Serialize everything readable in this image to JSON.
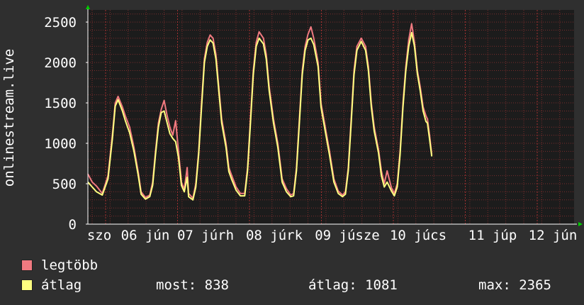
{
  "chart_data": {
    "type": "line",
    "ylabel": "onlinestream.live",
    "yticks": [
      "0",
      "500",
      "1000",
      "1500",
      "2000",
      "2500"
    ],
    "ylim": [
      0,
      2650
    ],
    "day_labels": [
      "szo",
      "06 jún",
      "07 júrh",
      "08 júrk",
      "09 júsze",
      "10 júcs",
      "11 júp",
      "12 jún"
    ],
    "grid": true,
    "colors": {
      "legtobb": "#f07a80",
      "atlag": "#ffff80",
      "background": "#1c1c1c",
      "grid": "#7a2c2c",
      "axis": "#ffffff",
      "arrow": "#00cc00"
    },
    "series": [
      {
        "name": "legtöbb",
        "color": "#f07a80",
        "points": [
          [
            0,
            620
          ],
          [
            0.06,
            520
          ],
          [
            0.12,
            470
          ],
          [
            0.2,
            380
          ],
          [
            0.28,
            600
          ],
          [
            0.34,
            1100
          ],
          [
            0.38,
            1500
          ],
          [
            0.42,
            1580
          ],
          [
            0.48,
            1450
          ],
          [
            0.52,
            1340
          ],
          [
            0.58,
            1200
          ],
          [
            0.64,
            950
          ],
          [
            0.7,
            640
          ],
          [
            0.74,
            400
          ],
          [
            0.8,
            330
          ],
          [
            0.86,
            360
          ],
          [
            0.9,
            520
          ],
          [
            0.94,
            900
          ],
          [
            0.98,
            1250
          ],
          [
            1.02,
            1420
          ],
          [
            1.06,
            1530
          ],
          [
            1.1,
            1350
          ],
          [
            1.14,
            1200
          ],
          [
            1.18,
            1100
          ],
          [
            1.22,
            1280
          ],
          [
            1.26,
            900
          ],
          [
            1.3,
            520
          ],
          [
            1.34,
            430
          ],
          [
            1.38,
            700
          ],
          [
            1.4,
            380
          ],
          [
            1.46,
            320
          ],
          [
            1.5,
            500
          ],
          [
            1.54,
            900
          ],
          [
            1.58,
            1500
          ],
          [
            1.62,
            2050
          ],
          [
            1.66,
            2250
          ],
          [
            1.7,
            2340
          ],
          [
            1.74,
            2300
          ],
          [
            1.78,
            2100
          ],
          [
            1.82,
            1700
          ],
          [
            1.86,
            1300
          ],
          [
            1.92,
            1000
          ],
          [
            1.96,
            700
          ],
          [
            2.0,
            600
          ],
          [
            2.06,
            460
          ],
          [
            2.12,
            380
          ],
          [
            2.18,
            380
          ],
          [
            2.22,
            700
          ],
          [
            2.26,
            1300
          ],
          [
            2.3,
            1900
          ],
          [
            2.34,
            2250
          ],
          [
            2.38,
            2380
          ],
          [
            2.44,
            2300
          ],
          [
            2.48,
            2100
          ],
          [
            2.52,
            1700
          ],
          [
            2.58,
            1300
          ],
          [
            2.64,
            1000
          ],
          [
            2.7,
            560
          ],
          [
            2.76,
            440
          ],
          [
            2.82,
            360
          ],
          [
            2.86,
            380
          ],
          [
            2.9,
            700
          ],
          [
            2.94,
            1300
          ],
          [
            2.98,
            1900
          ],
          [
            3.02,
            2200
          ],
          [
            3.06,
            2350
          ],
          [
            3.1,
            2440
          ],
          [
            3.14,
            2300
          ],
          [
            3.2,
            2000
          ],
          [
            3.24,
            1500
          ],
          [
            3.3,
            1200
          ],
          [
            3.36,
            900
          ],
          [
            3.42,
            560
          ],
          [
            3.48,
            410
          ],
          [
            3.54,
            360
          ],
          [
            3.58,
            400
          ],
          [
            3.62,
            700
          ],
          [
            3.66,
            1300
          ],
          [
            3.7,
            1900
          ],
          [
            3.74,
            2200
          ],
          [
            3.8,
            2300
          ],
          [
            3.86,
            2200
          ],
          [
            3.9,
            1950
          ],
          [
            3.94,
            1500
          ],
          [
            3.98,
            1200
          ],
          [
            4.04,
            920
          ],
          [
            4.08,
            660
          ],
          [
            4.12,
            500
          ],
          [
            4.16,
            660
          ],
          [
            4.22,
            450
          ],
          [
            4.26,
            380
          ],
          [
            4.3,
            500
          ],
          [
            4.34,
            900
          ],
          [
            4.38,
            1500
          ],
          [
            4.42,
            1950
          ],
          [
            4.46,
            2280
          ],
          [
            4.5,
            2480
          ],
          [
            4.54,
            2250
          ],
          [
            4.58,
            1900
          ],
          [
            4.62,
            1700
          ],
          [
            4.66,
            1450
          ],
          [
            4.7,
            1340
          ],
          [
            4.72,
            1300
          ],
          [
            4.75,
            1100
          ],
          [
            4.78,
            860
          ]
        ]
      },
      {
        "name": "átlag",
        "color": "#ffff80",
        "points": [
          [
            0,
            520
          ],
          [
            0.06,
            460
          ],
          [
            0.12,
            400
          ],
          [
            0.2,
            360
          ],
          [
            0.28,
            560
          ],
          [
            0.34,
            1050
          ],
          [
            0.38,
            1460
          ],
          [
            0.42,
            1540
          ],
          [
            0.48,
            1400
          ],
          [
            0.52,
            1280
          ],
          [
            0.58,
            1130
          ],
          [
            0.64,
            900
          ],
          [
            0.7,
            600
          ],
          [
            0.74,
            370
          ],
          [
            0.8,
            310
          ],
          [
            0.86,
            340
          ],
          [
            0.9,
            480
          ],
          [
            0.94,
            860
          ],
          [
            0.98,
            1200
          ],
          [
            1.02,
            1380
          ],
          [
            1.06,
            1400
          ],
          [
            1.1,
            1260
          ],
          [
            1.14,
            1120
          ],
          [
            1.18,
            1060
          ],
          [
            1.22,
            1020
          ],
          [
            1.26,
            820
          ],
          [
            1.3,
            480
          ],
          [
            1.34,
            400
          ],
          [
            1.38,
            580
          ],
          [
            1.4,
            340
          ],
          [
            1.46,
            300
          ],
          [
            1.5,
            460
          ],
          [
            1.54,
            860
          ],
          [
            1.58,
            1450
          ],
          [
            1.62,
            2000
          ],
          [
            1.66,
            2200
          ],
          [
            1.7,
            2280
          ],
          [
            1.74,
            2240
          ],
          [
            1.78,
            2040
          ],
          [
            1.82,
            1650
          ],
          [
            1.86,
            1250
          ],
          [
            1.92,
            950
          ],
          [
            1.96,
            650
          ],
          [
            2.0,
            550
          ],
          [
            2.06,
            420
          ],
          [
            2.12,
            350
          ],
          [
            2.18,
            350
          ],
          [
            2.22,
            660
          ],
          [
            2.26,
            1250
          ],
          [
            2.3,
            1850
          ],
          [
            2.34,
            2200
          ],
          [
            2.38,
            2300
          ],
          [
            2.44,
            2230
          ],
          [
            2.48,
            2040
          ],
          [
            2.52,
            1650
          ],
          [
            2.58,
            1250
          ],
          [
            2.64,
            950
          ],
          [
            2.7,
            520
          ],
          [
            2.76,
            400
          ],
          [
            2.82,
            340
          ],
          [
            2.86,
            350
          ],
          [
            2.9,
            660
          ],
          [
            2.94,
            1250
          ],
          [
            2.98,
            1850
          ],
          [
            3.02,
            2150
          ],
          [
            3.06,
            2280
          ],
          [
            3.1,
            2300
          ],
          [
            3.14,
            2220
          ],
          [
            3.2,
            1950
          ],
          [
            3.24,
            1450
          ],
          [
            3.3,
            1150
          ],
          [
            3.36,
            850
          ],
          [
            3.42,
            520
          ],
          [
            3.48,
            380
          ],
          [
            3.54,
            340
          ],
          [
            3.58,
            370
          ],
          [
            3.62,
            660
          ],
          [
            3.66,
            1250
          ],
          [
            3.7,
            1850
          ],
          [
            3.74,
            2150
          ],
          [
            3.8,
            2260
          ],
          [
            3.86,
            2150
          ],
          [
            3.9,
            1900
          ],
          [
            3.94,
            1450
          ],
          [
            3.98,
            1150
          ],
          [
            4.04,
            880
          ],
          [
            4.08,
            600
          ],
          [
            4.12,
            460
          ],
          [
            4.16,
            520
          ],
          [
            4.22,
            410
          ],
          [
            4.26,
            350
          ],
          [
            4.3,
            460
          ],
          [
            4.34,
            860
          ],
          [
            4.38,
            1450
          ],
          [
            4.42,
            1900
          ],
          [
            4.46,
            2200
          ],
          [
            4.5,
            2370
          ],
          [
            4.54,
            2200
          ],
          [
            4.58,
            1860
          ],
          [
            4.62,
            1650
          ],
          [
            4.66,
            1400
          ],
          [
            4.7,
            1270
          ],
          [
            4.72,
            1250
          ],
          [
            4.75,
            1050
          ],
          [
            4.78,
            838
          ]
        ]
      }
    ],
    "legend": [
      "legtöbb",
      "átlag"
    ],
    "stats": {
      "most": "most: 838",
      "atlag": "átlag: 1081",
      "max": "max: 2365"
    }
  }
}
